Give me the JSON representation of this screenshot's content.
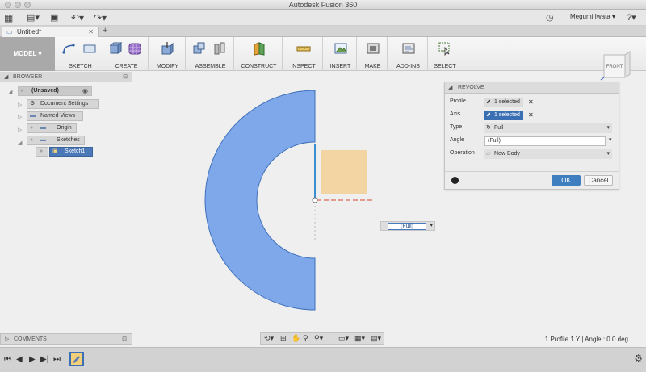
{
  "window": {
    "title": "Autodesk Fusion 360"
  },
  "quick_access": {
    "user_name": "Megumi Iwata"
  },
  "doc_tab": {
    "label": "Untitled*"
  },
  "ribbon": {
    "workspace_label": "MODEL",
    "groups": [
      "SKETCH",
      "CREATE",
      "MODIFY",
      "ASSEMBLE",
      "CONSTRUCT",
      "INSPECT",
      "INSERT",
      "MAKE",
      "ADD-INS",
      "SELECT"
    ]
  },
  "browser": {
    "header": "BROWSER",
    "items": [
      "(Unsaved)",
      "Document Settings",
      "Named Views",
      "Origin",
      "Sketches",
      "Sketch1"
    ]
  },
  "viewcube": {
    "face_label": "FRONT"
  },
  "revolve_panel": {
    "title": "REVOLVE",
    "rows": [
      {
        "label": "Profile",
        "value": "1 selected"
      },
      {
        "label": "Axis",
        "value": "1 selected"
      },
      {
        "label": "Type",
        "value": "Full"
      },
      {
        "label": "Angle",
        "value": "(Full)"
      },
      {
        "label": "Operation",
        "value": "New Body"
      }
    ],
    "ok_label": "OK",
    "cancel_label": "Cancel"
  },
  "canvas_input": {
    "value": "(Full)"
  },
  "comments": {
    "header": "COMMENTS"
  },
  "status_bar": {
    "text": "1 Profile 1 Y | Angle : 0.0 deg"
  },
  "colors": {
    "profile_fill": "#7ea8ea",
    "profile_stroke": "#3e6fb8",
    "sketch_fill": "#f2d5a3",
    "selected_blue": "#3b6fb4",
    "ok_button": "#3f7fc0"
  }
}
